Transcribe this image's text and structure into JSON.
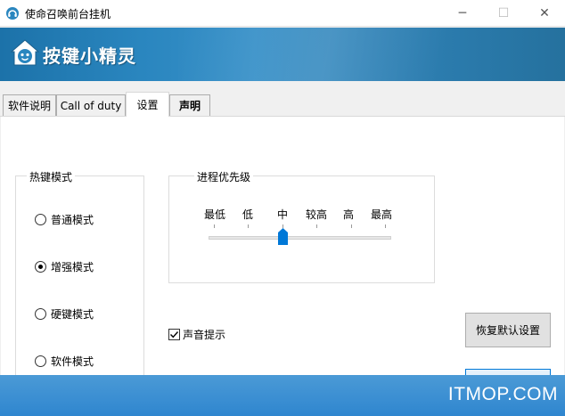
{
  "window": {
    "title": "使命召唤前台挂机",
    "minimize_glyph": "─",
    "maximize_glyph": "☐",
    "close_glyph": "✕"
  },
  "banner": {
    "logo_text": "按键小精灵",
    "logo_icon": "house-face-icon"
  },
  "tabs": [
    {
      "label": "软件说明",
      "active": false
    },
    {
      "label": "Call of duty",
      "active": false
    },
    {
      "label": "设置",
      "active": true
    },
    {
      "label": "声明",
      "active": false
    }
  ],
  "hotkey_mode": {
    "title": "热键模式",
    "options": [
      {
        "label": "普通模式",
        "checked": false
      },
      {
        "label": "增强模式",
        "checked": true
      },
      {
        "label": "硬键模式",
        "checked": false
      },
      {
        "label": "软件模式",
        "checked": false
      }
    ]
  },
  "priority": {
    "title": "进程优先级",
    "levels": [
      "最低",
      "低",
      "中",
      "较高",
      "高",
      "最高"
    ],
    "selected": "中"
  },
  "sound_prompt": {
    "label": "声音提示",
    "checked": true
  },
  "buttons": {
    "restore_defaults": "恢复默认设置"
  },
  "watermark": "ITMOP.COM",
  "colors": {
    "banner_blue": "#2a86bf",
    "footer_blue": "#3a8fd4",
    "slider_thumb": "#0078d7"
  }
}
